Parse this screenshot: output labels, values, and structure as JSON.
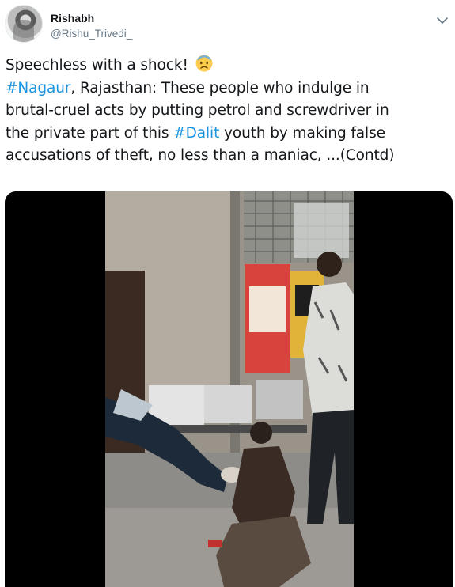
{
  "author": {
    "name": "Rishabh",
    "handle": "@Rishu_Trivedi_"
  },
  "tweet": {
    "line1_text": "Speechless with a shock!",
    "line1_emoji": "anxious-face-emoji",
    "line2_hashtag": "#Nagaur",
    "line2_rest": ", Rajasthan: These people who indulge in",
    "line3": "brutal-cruel acts by putting petrol and screwdriver in",
    "line4_before": "the private part of this ",
    "line4_hashtag": "#Dalit",
    "line4_after": " youth by making false",
    "line5": "accusations of theft, no less than a maniac, ...(Contd)"
  },
  "media": {
    "type": "video",
    "icon": "video-frame"
  },
  "icons": {
    "more": "chevron-down-icon",
    "avatar": "avatar"
  },
  "colors": {
    "hashtag": "#1b95e0",
    "handle": "#657786",
    "text": "#14171a",
    "media_background": "#000000"
  }
}
